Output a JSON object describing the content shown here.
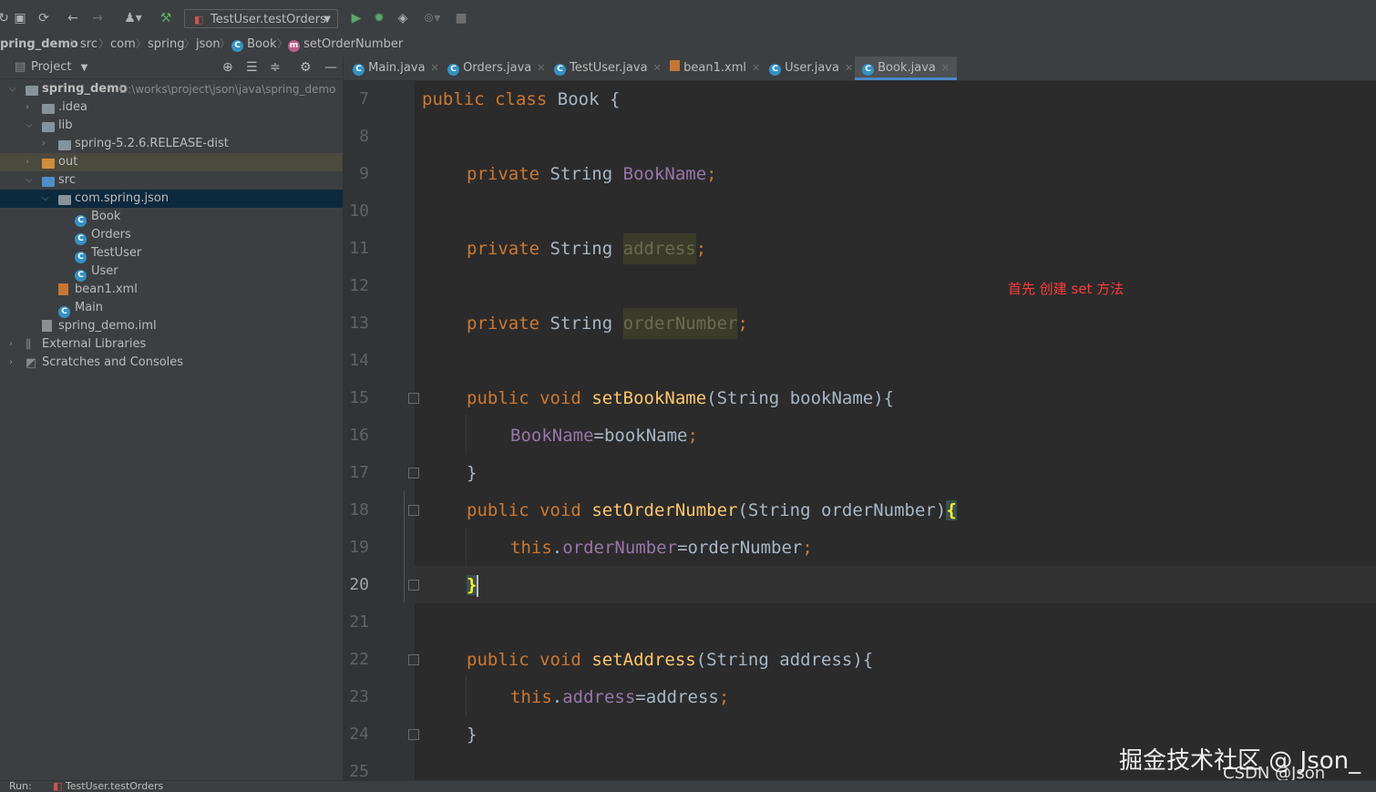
{
  "run_config": {
    "label": "TestUser.testOrders"
  },
  "breadcrumb": [
    "pring_demo",
    "src",
    "com",
    "spring",
    "json",
    "Book",
    "setOrderNumber"
  ],
  "sidebar": {
    "title": "Project",
    "tree": [
      {
        "label": "spring_demo",
        "path": "D:\\works\\project\\json\\java\\spring_demo"
      },
      {
        "label": ".idea"
      },
      {
        "label": "lib"
      },
      {
        "label": "spring-5.2.6.RELEASE-dist"
      },
      {
        "label": "out"
      },
      {
        "label": "src"
      },
      {
        "label": "com.spring.json"
      },
      {
        "label": "Book"
      },
      {
        "label": "Orders"
      },
      {
        "label": "TestUser"
      },
      {
        "label": "User"
      },
      {
        "label": "bean1.xml"
      },
      {
        "label": "Main"
      },
      {
        "label": "spring_demo.iml"
      },
      {
        "label": "External Libraries"
      },
      {
        "label": "Scratches and Consoles"
      }
    ]
  },
  "tabs": [
    "Main.java",
    "Orders.java",
    "TestUser.java",
    "bean1.xml",
    "User.java",
    "Book.java"
  ],
  "editor": {
    "line_numbers": [
      "7",
      "8",
      "9",
      "10",
      "11",
      "12",
      "13",
      "14",
      "15",
      "16",
      "17",
      "18",
      "19",
      "20",
      "21",
      "22",
      "23",
      "24",
      "25"
    ],
    "tokens": {
      "public": "public",
      "class": "class",
      "book_class": "Book",
      "open": "{",
      "close": "}",
      "private": "private",
      "string": "String",
      "void": "void",
      "this": "this",
      "f_bookname": "BookName",
      "f_address": "address",
      "f_ordernumber": "orderNumber",
      "m_setbookname": "setBookName",
      "m_setordernumber": "setOrderNumber",
      "m_setaddress": "setAddress",
      "p_bookname": "bookName",
      "p_ordernumber": "orderNumber",
      "p_address": "address",
      "semicolon": ";",
      "dot": ".",
      "eq": "=",
      "lparen": "(",
      "rparen": ")"
    }
  },
  "annotation": "首先 创建 set 方法",
  "watermark": "掘金技术社区 @ Json_",
  "watermark2": "CSDN @Json___",
  "statusbar": {
    "label": "Run:",
    "config": "TestUser.testOrders"
  }
}
